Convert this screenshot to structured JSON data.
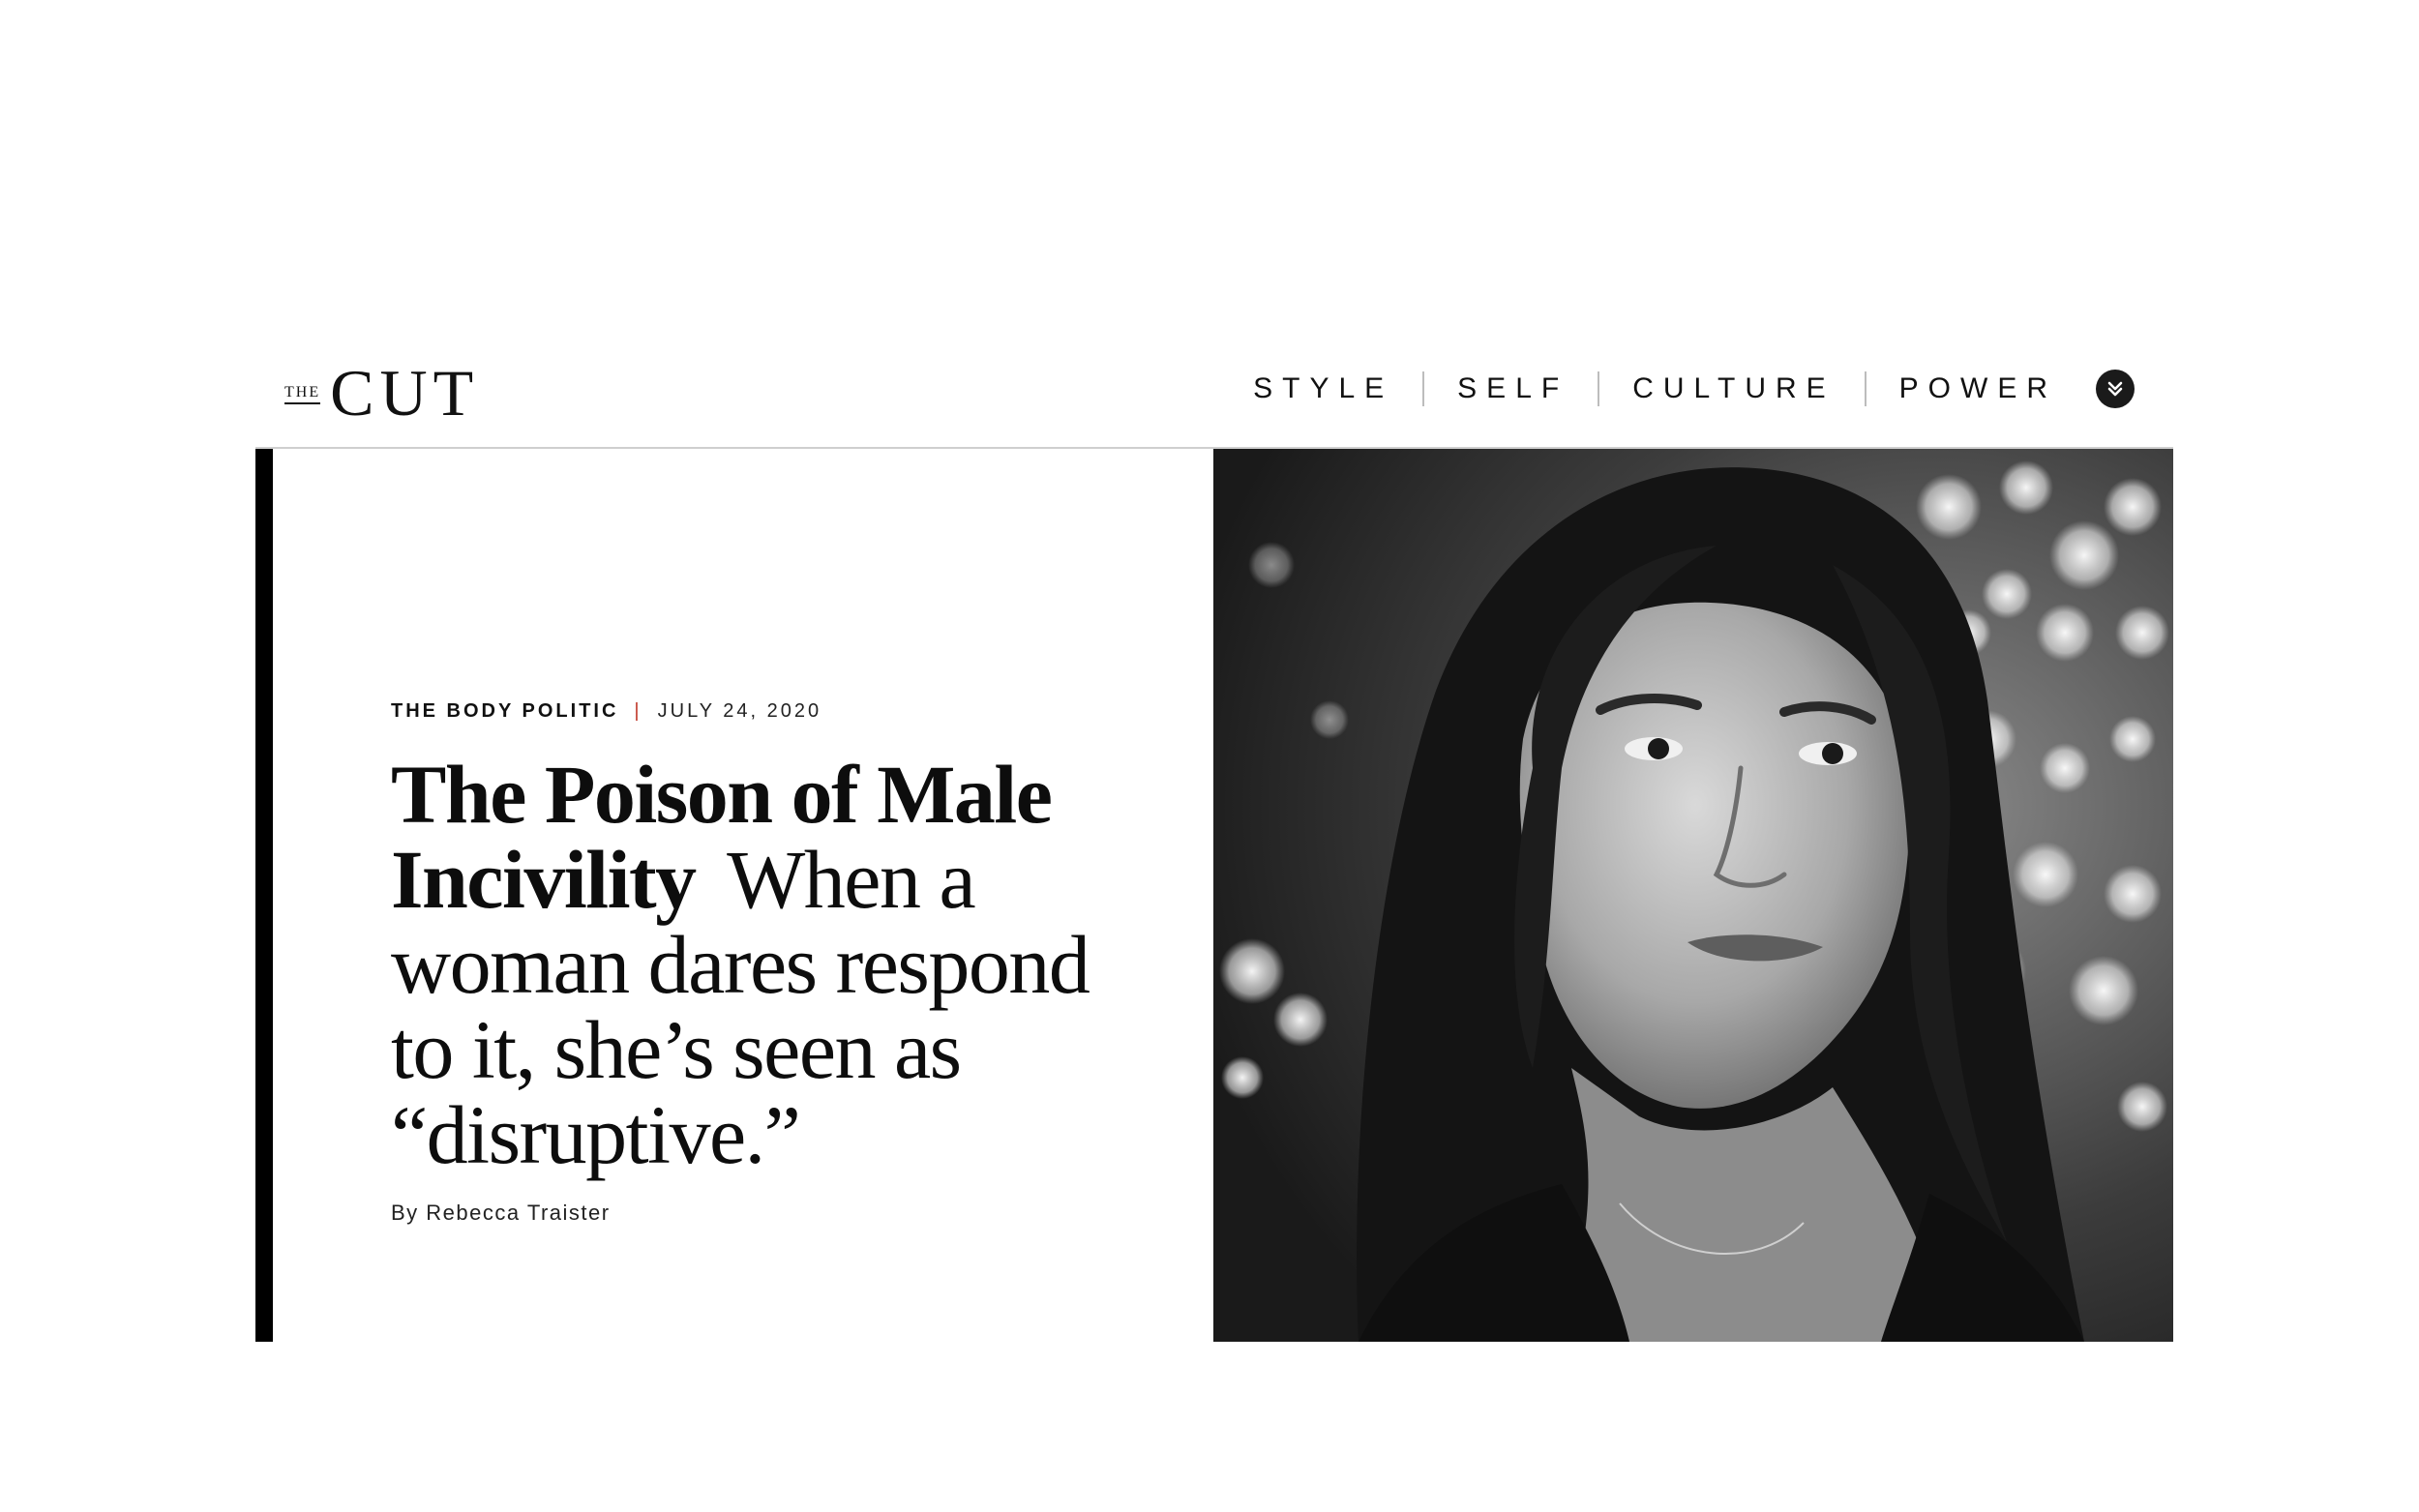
{
  "header": {
    "logo": {
      "the": "THE",
      "name": "CUT"
    },
    "nav": [
      {
        "label": "STYLE"
      },
      {
        "label": "SELF"
      },
      {
        "label": "CULTURE"
      },
      {
        "label": "POWER"
      }
    ],
    "more_icon": "chevron-double-down-icon"
  },
  "hero": {
    "rubric": "THE BODY POLITIC",
    "separator": "|",
    "date": "JULY 24, 2020",
    "headline": "The Poison of Male Incivility",
    "dek": "When a woman dares respond to it, she’s seen as “disruptive.”",
    "byline": "By Rebecca Traister",
    "image_icon": "portrait-photo"
  },
  "colors": {
    "accent_separator": "#c0392b",
    "bar": "#000000",
    "text": "#111111"
  }
}
